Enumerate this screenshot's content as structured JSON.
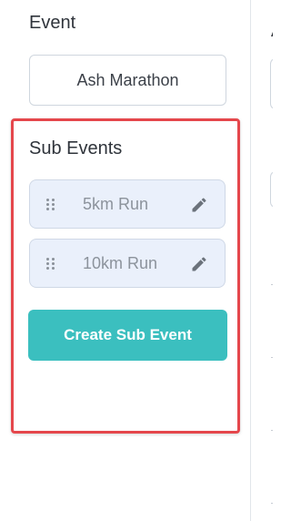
{
  "event": {
    "label": "Event",
    "name": "Ash Marathon"
  },
  "sub_events": {
    "label": "Sub Events",
    "items": [
      {
        "label": "5km Run",
        "handle_icon": "drag-handle-icon",
        "action_icon": "pencil-icon"
      },
      {
        "label": "10km Run",
        "handle_icon": "drag-handle-icon",
        "action_icon": "pencil-icon"
      }
    ],
    "create_button": "Create Sub Event"
  },
  "right_panel": {
    "header_partial": "A"
  },
  "colors": {
    "highlight_border": "#e5474c",
    "button_bg": "#3bbfbf",
    "item_bg": "#eaf0fb",
    "item_text": "#8c939c"
  }
}
